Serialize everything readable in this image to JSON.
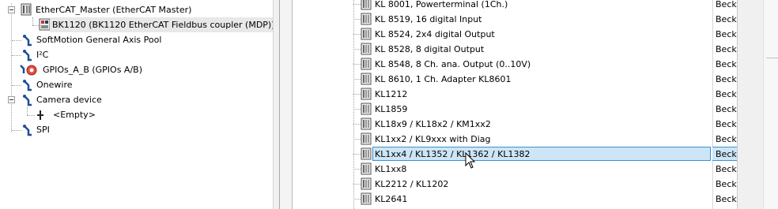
{
  "device_tree": {
    "items": [
      {
        "label": "EtherCAT_Master (EtherCAT Master)",
        "icon": "ethercat-master-icon"
      },
      {
        "label": "BK1120 (BK1120 EtherCAT Fieldbus coupler (MDP))",
        "icon": "fieldbus-coupler-icon"
      },
      {
        "label": "SoftMotion General Axis Pool",
        "icon": "device-icon"
      },
      {
        "label": "I²C",
        "icon": "device-icon"
      },
      {
        "label": "GPIOs_A_B (GPIOs A/B)",
        "icon": "gpio-icon"
      },
      {
        "label": "Onewire",
        "icon": "device-icon"
      },
      {
        "label": "Camera device",
        "icon": "device-icon"
      },
      {
        "label": "<Empty>",
        "icon": "empty-slot-icon"
      },
      {
        "label": "SPI",
        "icon": "device-icon"
      }
    ]
  },
  "module_list": {
    "vendor_text": "Beckh",
    "selected_index": 10,
    "items": [
      {
        "name": "KL 8001, Powerterminal (1Ch.)",
        "vendor": "Beckh"
      },
      {
        "name": "KL 8519, 16 digital Input",
        "vendor": "Beckh"
      },
      {
        "name": "KL 8524, 2x4 digital Output",
        "vendor": "Beckh"
      },
      {
        "name": "KL 8528, 8 digital Output",
        "vendor": "Beckh"
      },
      {
        "name": "KL 8548, 8 Ch. ana. Output (0..10V)",
        "vendor": "Beckh"
      },
      {
        "name": "KL 8610, 1 Ch. Adapter KL8601",
        "vendor": "Beckh"
      },
      {
        "name": "KL1212",
        "vendor": "Beckh"
      },
      {
        "name": "KL1859",
        "vendor": "Beckh"
      },
      {
        "name": "KL18x9 / KL18x2 / KM1xx2",
        "vendor": "Beckh"
      },
      {
        "name": "KL1xx2 / KL9xxx with Diag",
        "vendor": "Beckh"
      },
      {
        "name": "KL1xx4 / KL1352 / KL1362 / KL1382",
        "vendor": "Beckh"
      },
      {
        "name": "KL1xx8",
        "vendor": "Beckh"
      },
      {
        "name": "KL2212 / KL1202",
        "vendor": "Beckh"
      },
      {
        "name": "KL2641",
        "vendor": "Beckh"
      }
    ]
  },
  "colors": {
    "selection_bg": "#cde6f7",
    "selection_border": "#3d8fd1",
    "tree_line": "#a0a0a0"
  }
}
